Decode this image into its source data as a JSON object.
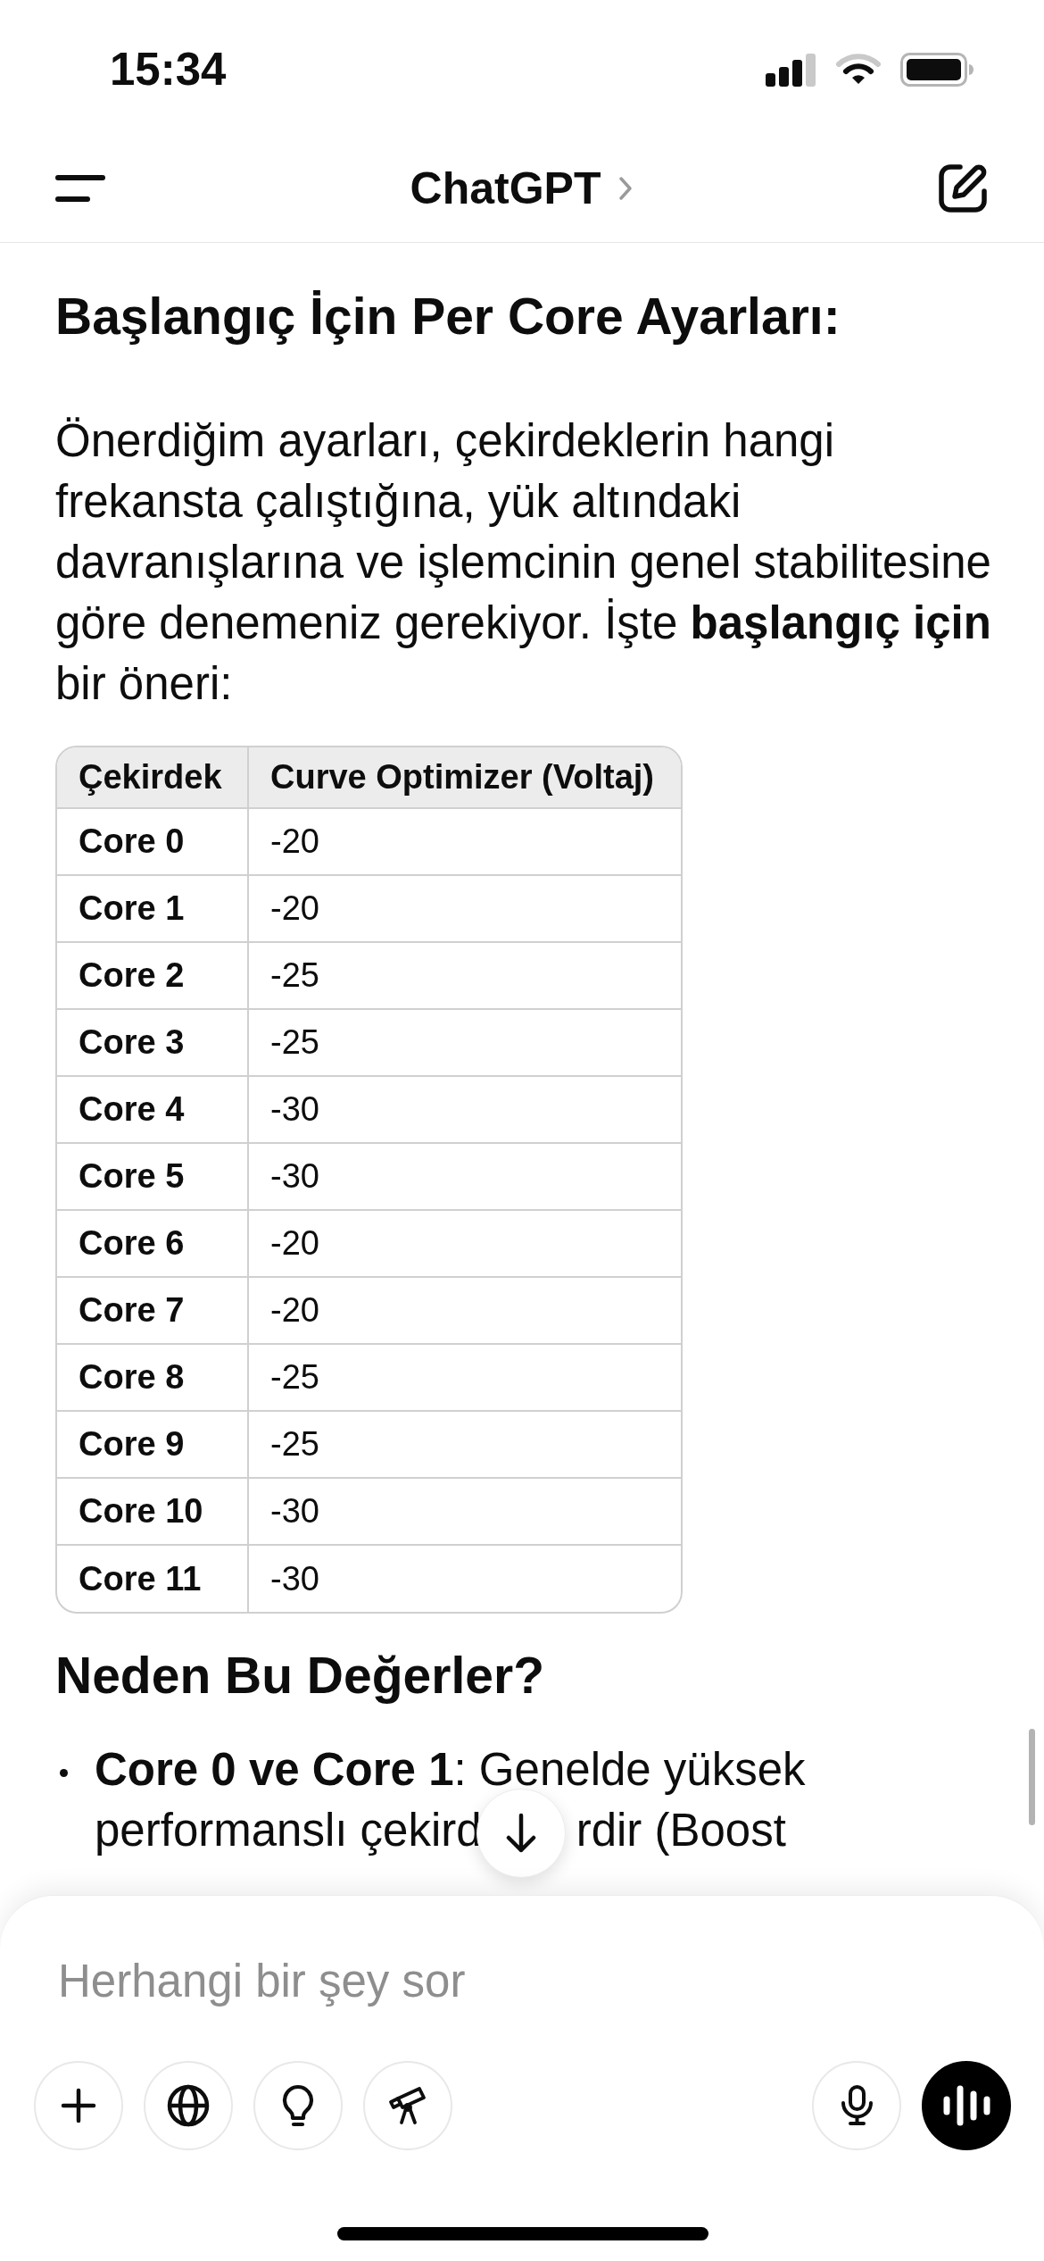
{
  "status_bar": {
    "time": "15:34"
  },
  "header": {
    "title": "ChatGPT"
  },
  "message": {
    "blocks": [
      {
        "kind": "heading",
        "text": "Başlangıç İçin Per Core Ayarları:"
      },
      {
        "kind": "paragraph",
        "text": "Önerdiğim ayarları, çekirdeklerin hangi frekansta çalıştığına, yük altındaki davranışlarına ve işlemcinin genel stabilitesine göre denemeniz gerekiyor. İşte **başlangıç için** bir öneri:"
      },
      {
        "kind": "table",
        "columns": [
          "Çekirdek",
          "Curve Optimizer (Voltaj)"
        ],
        "rows": [
          [
            "Core 0",
            "-20"
          ],
          [
            "Core 1",
            "-20"
          ],
          [
            "Core 2",
            "-25"
          ],
          [
            "Core 3",
            "-25"
          ],
          [
            "Core 4",
            "-30"
          ],
          [
            "Core 5",
            "-30"
          ],
          [
            "Core 6",
            "-20"
          ],
          [
            "Core 7",
            "-20"
          ],
          [
            "Core 8",
            "-25"
          ],
          [
            "Core 9",
            "-25"
          ],
          [
            "Core 10",
            "-30"
          ],
          [
            "Core 11",
            "-30"
          ]
        ]
      },
      {
        "kind": "heading",
        "text": "Neden Bu Değerler?"
      },
      {
        "kind": "bullets",
        "items": [
          {
            "lines": [
              [
                "**Core 0 ve Core 1**: Genelde yüksek"
              ],
              [
                "performanslı çekird",
                "rdir (Boost"
              ]
            ]
          }
        ]
      }
    ]
  },
  "composer": {
    "placeholder": "Herhangi bir şey sor"
  }
}
